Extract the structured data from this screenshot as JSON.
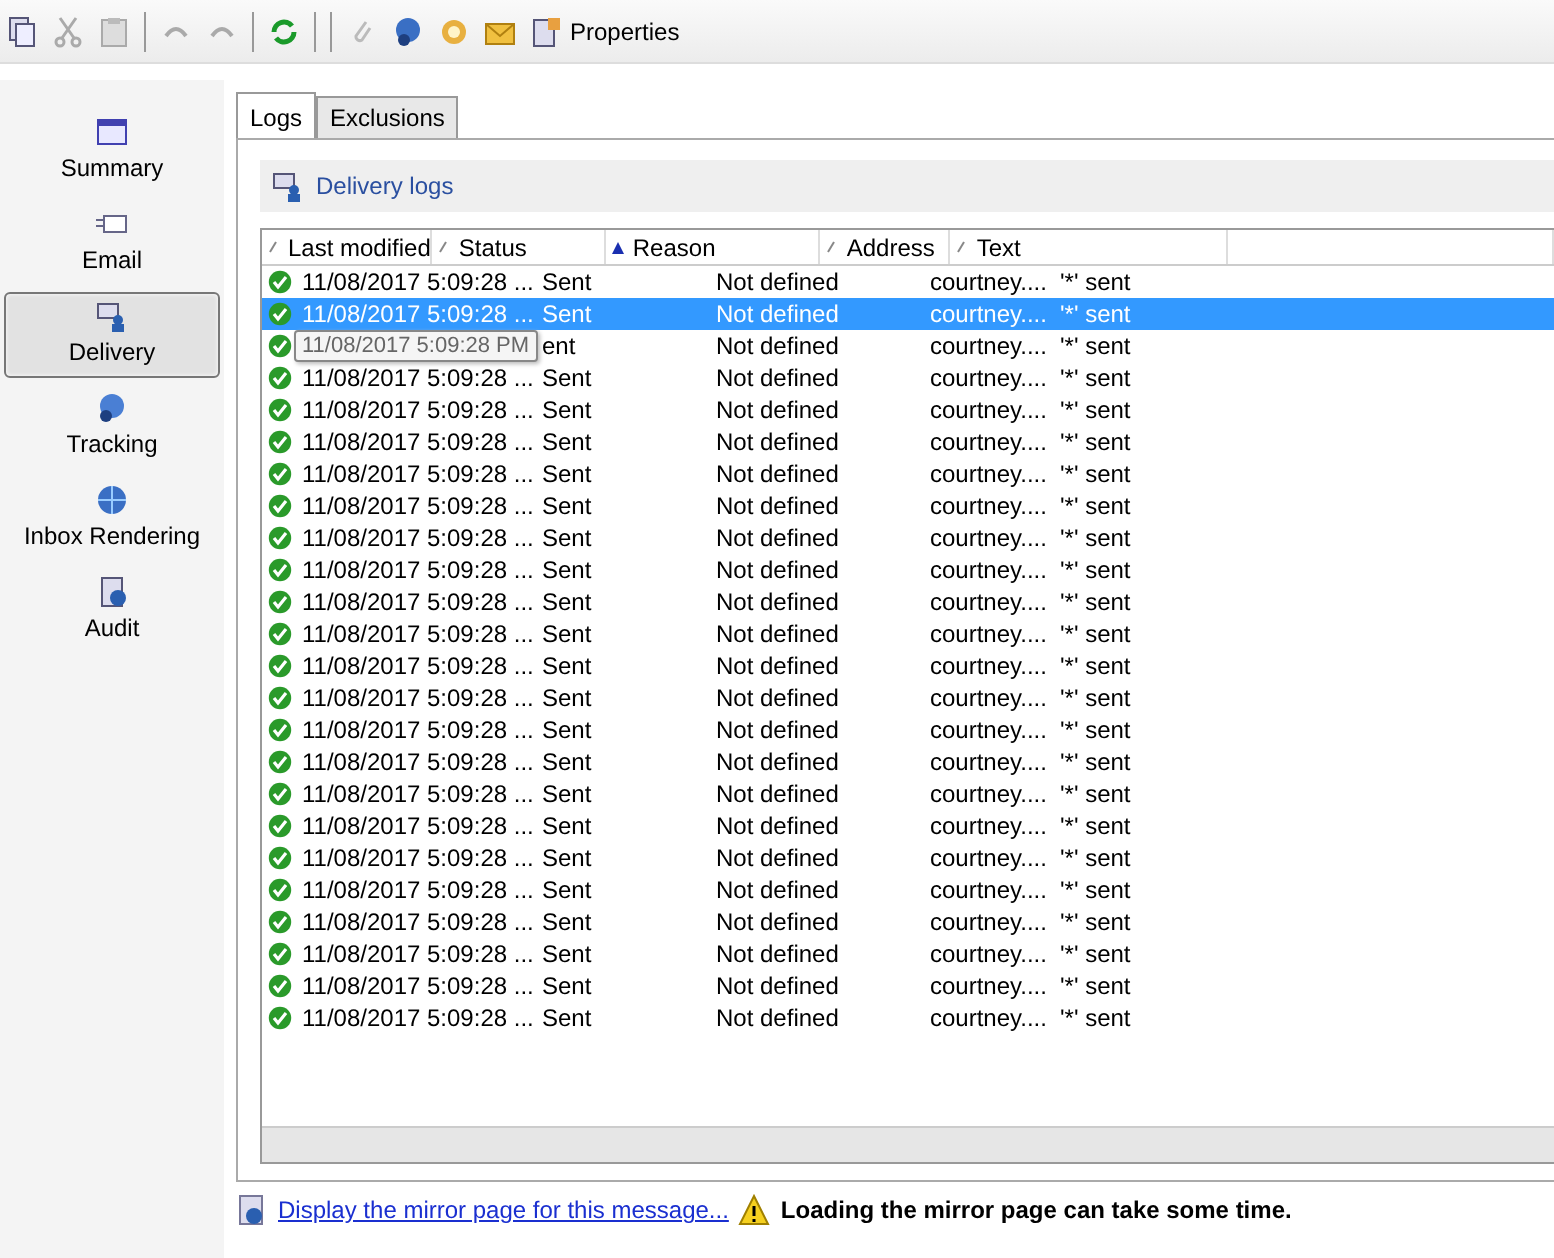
{
  "toolbar": {
    "properties_label": "Properties"
  },
  "sidebar": {
    "items": [
      {
        "label": "Summary",
        "selected": false
      },
      {
        "label": "Email",
        "selected": false
      },
      {
        "label": "Delivery",
        "selected": true
      },
      {
        "label": "Tracking",
        "selected": false
      },
      {
        "label": "Inbox Rendering",
        "selected": false
      },
      {
        "label": "Audit",
        "selected": false
      }
    ]
  },
  "tabs": [
    {
      "label": "Logs",
      "selected": true
    },
    {
      "label": "Exclusions",
      "selected": false
    }
  ],
  "section_title": "Delivery logs",
  "table": {
    "columns": [
      {
        "label": "Last modified",
        "sorted": false
      },
      {
        "label": "Status",
        "sorted": false
      },
      {
        "label": "Reason",
        "sorted": true
      },
      {
        "label": "Address",
        "sorted": false
      },
      {
        "label": "Text",
        "sorted": false
      }
    ],
    "rows": [
      {
        "last_modified": "11/08/2017 5:09:28 ...",
        "status": "Sent",
        "reason": "Not defined",
        "address": "courtney....",
        "text": "'*' sent",
        "selected": false
      },
      {
        "last_modified": "11/08/2017 5:09:28 ...",
        "status": "Sent",
        "reason": "Not defined",
        "address": "courtney....",
        "text": "'*' sent",
        "selected": true
      },
      {
        "status": "ent",
        "reason": "Not defined",
        "address": "courtney....",
        "text": "'*' sent",
        "selected": false
      },
      {
        "last_modified": "11/08/2017 5:09:28 ...",
        "status": "Sent",
        "reason": "Not defined",
        "address": "courtney....",
        "text": "'*' sent",
        "selected": false
      },
      {
        "last_modified": "11/08/2017 5:09:28 ...",
        "status": "Sent",
        "reason": "Not defined",
        "address": "courtney....",
        "text": "'*' sent",
        "selected": false
      },
      {
        "last_modified": "11/08/2017 5:09:28 ...",
        "status": "Sent",
        "reason": "Not defined",
        "address": "courtney....",
        "text": "'*' sent",
        "selected": false
      },
      {
        "last_modified": "11/08/2017 5:09:28 ...",
        "status": "Sent",
        "reason": "Not defined",
        "address": "courtney....",
        "text": "'*' sent",
        "selected": false
      },
      {
        "last_modified": "11/08/2017 5:09:28 ...",
        "status": "Sent",
        "reason": "Not defined",
        "address": "courtney....",
        "text": "'*' sent",
        "selected": false
      },
      {
        "last_modified": "11/08/2017 5:09:28 ...",
        "status": "Sent",
        "reason": "Not defined",
        "address": "courtney....",
        "text": "'*' sent",
        "selected": false
      },
      {
        "last_modified": "11/08/2017 5:09:28 ...",
        "status": "Sent",
        "reason": "Not defined",
        "address": "courtney....",
        "text": "'*' sent",
        "selected": false
      },
      {
        "last_modified": "11/08/2017 5:09:28 ...",
        "status": "Sent",
        "reason": "Not defined",
        "address": "courtney....",
        "text": "'*' sent",
        "selected": false
      },
      {
        "last_modified": "11/08/2017 5:09:28 ...",
        "status": "Sent",
        "reason": "Not defined",
        "address": "courtney....",
        "text": "'*' sent",
        "selected": false
      },
      {
        "last_modified": "11/08/2017 5:09:28 ...",
        "status": "Sent",
        "reason": "Not defined",
        "address": "courtney....",
        "text": "'*' sent",
        "selected": false
      },
      {
        "last_modified": "11/08/2017 5:09:28 ...",
        "status": "Sent",
        "reason": "Not defined",
        "address": "courtney....",
        "text": "'*' sent",
        "selected": false
      },
      {
        "last_modified": "11/08/2017 5:09:28 ...",
        "status": "Sent",
        "reason": "Not defined",
        "address": "courtney....",
        "text": "'*' sent",
        "selected": false
      },
      {
        "last_modified": "11/08/2017 5:09:28 ...",
        "status": "Sent",
        "reason": "Not defined",
        "address": "courtney....",
        "text": "'*' sent",
        "selected": false
      },
      {
        "last_modified": "11/08/2017 5:09:28 ...",
        "status": "Sent",
        "reason": "Not defined",
        "address": "courtney....",
        "text": "'*' sent",
        "selected": false
      },
      {
        "last_modified": "11/08/2017 5:09:28 ...",
        "status": "Sent",
        "reason": "Not defined",
        "address": "courtney....",
        "text": "'*' sent",
        "selected": false
      },
      {
        "last_modified": "11/08/2017 5:09:28 ...",
        "status": "Sent",
        "reason": "Not defined",
        "address": "courtney....",
        "text": "'*' sent",
        "selected": false
      },
      {
        "last_modified": "11/08/2017 5:09:28 ...",
        "status": "Sent",
        "reason": "Not defined",
        "address": "courtney....",
        "text": "'*' sent",
        "selected": false
      },
      {
        "last_modified": "11/08/2017 5:09:28 ...",
        "status": "Sent",
        "reason": "Not defined",
        "address": "courtney....",
        "text": "'*' sent",
        "selected": false
      },
      {
        "last_modified": "11/08/2017 5:09:28 ...",
        "status": "Sent",
        "reason": "Not defined",
        "address": "courtney....",
        "text": "'*' sent",
        "selected": false
      },
      {
        "last_modified": "11/08/2017 5:09:28 ...",
        "status": "Sent",
        "reason": "Not defined",
        "address": "courtney....",
        "text": "'*' sent",
        "selected": false
      },
      {
        "last_modified": "11/08/2017 5:09:28 ...",
        "status": "Sent",
        "reason": "Not defined",
        "address": "courtney....",
        "text": "'*' sent",
        "selected": false
      }
    ]
  },
  "tooltip": "11/08/2017 5:09:28 PM",
  "footer": {
    "link": "Display the mirror page for this message...",
    "warning": "Loading the mirror page can take some time."
  }
}
